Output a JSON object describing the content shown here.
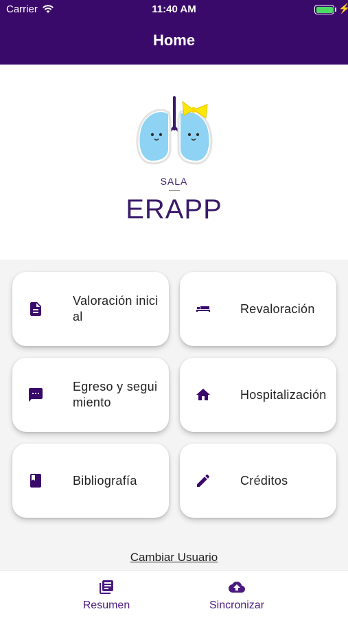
{
  "status_bar": {
    "carrier": "Carrier",
    "time": "11:40 AM"
  },
  "header": {
    "title": "Home"
  },
  "logo": {
    "sala": "SALA",
    "brand": "ERAPP"
  },
  "menu": [
    {
      "label": "Valoración inicial",
      "icon": "document-icon"
    },
    {
      "label": "Revaloración",
      "icon": "bed-icon"
    },
    {
      "label": "Egreso y seguimiento",
      "icon": "message-icon"
    },
    {
      "label": "Hospitalización",
      "icon": "home-icon"
    },
    {
      "label": "Bibliografía",
      "icon": "book-icon"
    },
    {
      "label": "Créditos",
      "icon": "pencil-icon"
    }
  ],
  "footer_link": {
    "label": "Cambiar Usuario"
  },
  "tabbar": {
    "items": [
      {
        "label": "Resumen",
        "icon": "newspaper-icon"
      },
      {
        "label": "Sincronizar",
        "icon": "cloud-upload-icon"
      }
    ]
  },
  "colors": {
    "primary": "#3a0a6b",
    "accent_text": "#4a1a80",
    "lung": "#8fd3f4",
    "bow": "#ffe600"
  }
}
